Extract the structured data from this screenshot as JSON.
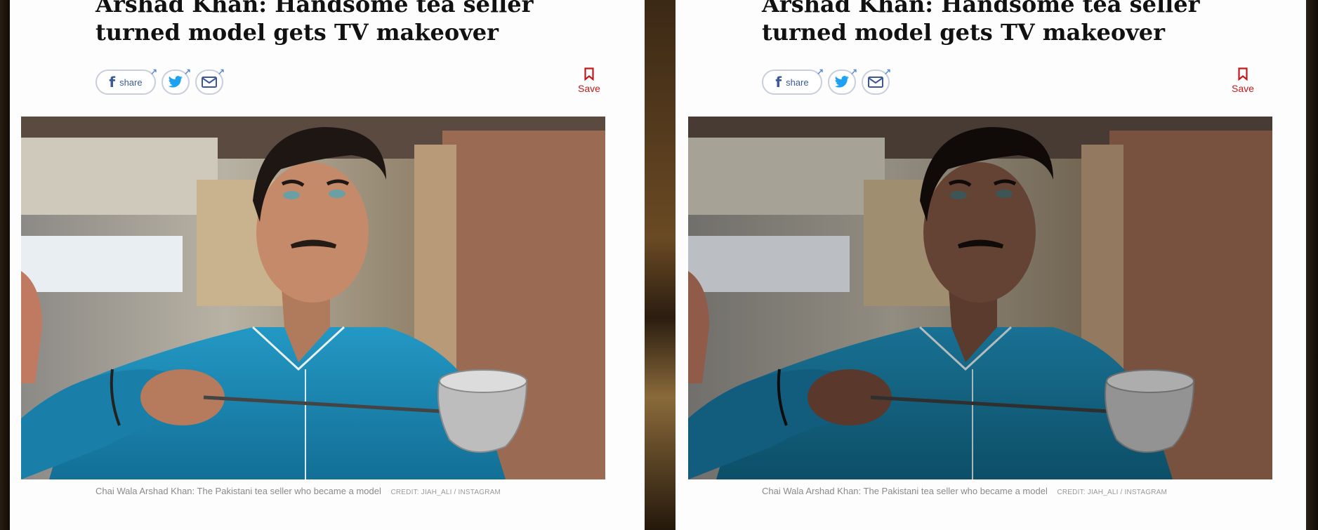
{
  "article": {
    "headline_line1": "Arshad Khan: Handsome tea seller",
    "headline_line2": "turned model gets TV makeover",
    "share_label": "share",
    "save_label": "Save",
    "caption": "Chai Wala Arshad Khan: The Pakistani tea seller who became a model",
    "credit": "CREDIT: JIAH_ALI / INSTAGRAM"
  },
  "icons": {
    "facebook": "facebook-icon",
    "twitter": "twitter-icon",
    "email": "email-icon",
    "bookmark": "bookmark-icon"
  },
  "colors": {
    "save_red": "#c01a1a",
    "facebook_blue": "#3b5998",
    "twitter_blue": "#1da1f2",
    "shirt_teal": "#1f8bb5"
  }
}
